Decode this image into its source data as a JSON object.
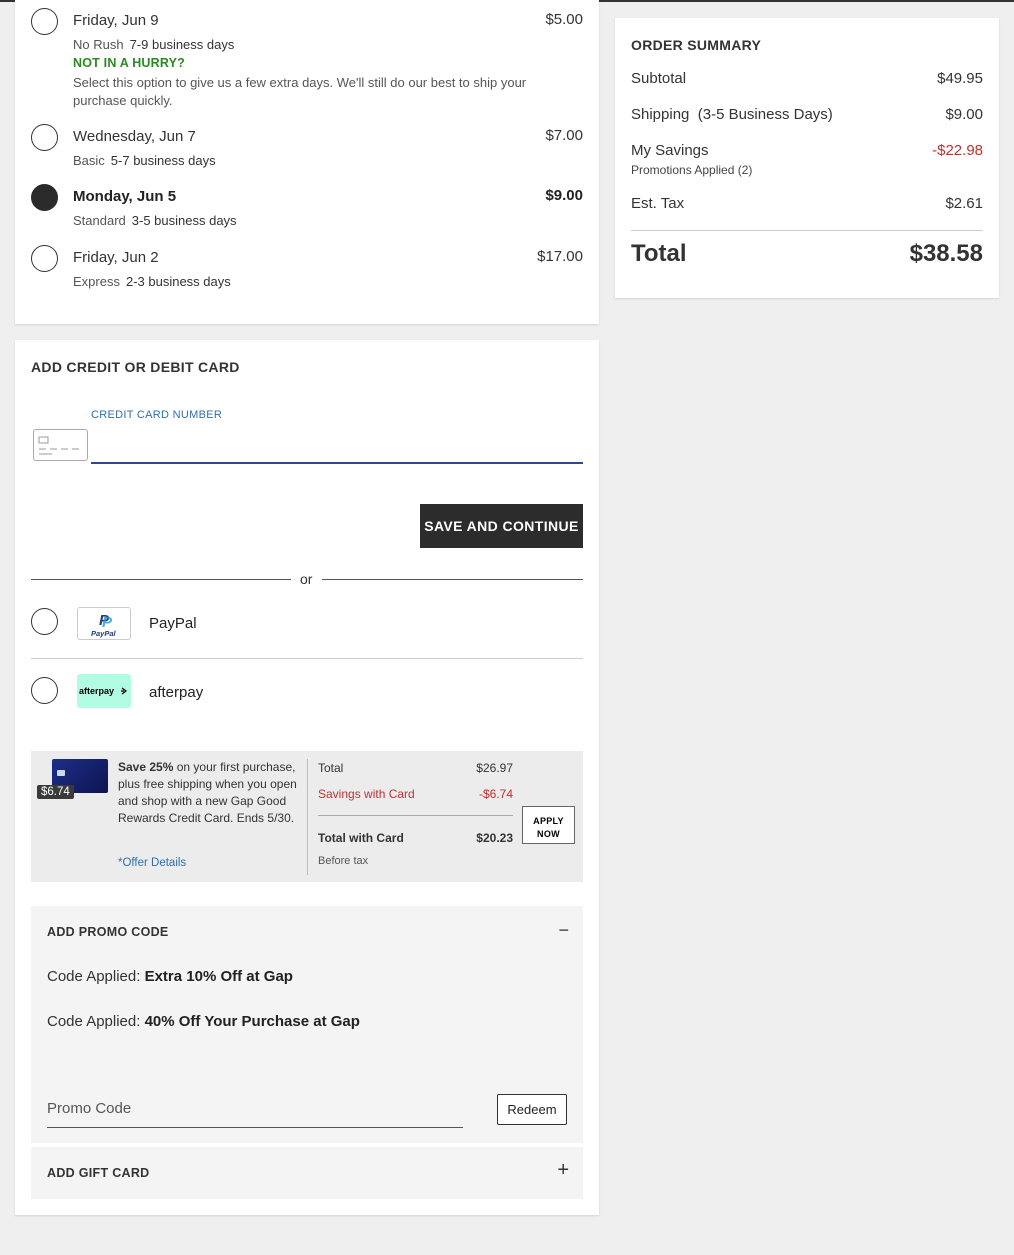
{
  "shipping": {
    "options": [
      {
        "date": "Friday, Jun 9",
        "price": "$5.00",
        "tier": "No Rush",
        "days": "7-9 business days",
        "selected": false,
        "note_title": "NOT IN A HURRY?",
        "note_text": "Select this option to give us a few extra days. We'll still do our best to ship your purchase quickly."
      },
      {
        "date": "Wednesday, Jun 7",
        "price": "$7.00",
        "tier": "Basic",
        "days": "5-7 business days",
        "selected": false
      },
      {
        "date": "Monday, Jun 5",
        "price": "$9.00",
        "tier": "Standard",
        "days": "3-5 business days",
        "selected": true
      },
      {
        "date": "Friday, Jun 2",
        "price": "$17.00",
        "tier": "Express",
        "days": "2-3 business days",
        "selected": false
      }
    ]
  },
  "payment": {
    "title": "ADD CREDIT OR DEBIT CARD",
    "card_number_label": "CREDIT CARD NUMBER",
    "card_number_value": "",
    "save_button": "SAVE AND CONTINUE",
    "or_text": "or",
    "paypal": {
      "label": "PayPal",
      "logo_text": "PayPal"
    },
    "afterpay": {
      "label": "afterpay",
      "logo_text": "afterpay"
    }
  },
  "rewards": {
    "badge": "$6.74",
    "promo_bold": "Save 25%",
    "promo_text": " on your first purchase, plus free shipping when you open and shop with a new Gap Good Rewards Credit Card. Ends 5/30.",
    "offer_link": "*Offer Details",
    "total_label": "Total",
    "total_value": "$26.97",
    "savings_label": "Savings with Card",
    "savings_value": "-$6.74",
    "card_total_label": "Total with Card",
    "card_total_value": "$20.23",
    "before_tax": "Before tax",
    "apply_line1": "APPLY",
    "apply_line2": "NOW"
  },
  "promo": {
    "title": "ADD PROMO CODE",
    "toggle": "−",
    "code_prefix": "Code Applied: ",
    "codes": [
      "Extra 10% Off at Gap",
      "40% Off Your Purchase at Gap"
    ],
    "input_placeholder": "Promo Code",
    "redeem_button": "Redeem"
  },
  "gift": {
    "title": "ADD GIFT CARD",
    "toggle": "+"
  },
  "summary": {
    "title": "ORDER SUMMARY",
    "subtotal_label": "Subtotal",
    "subtotal_value": "$49.95",
    "shipping_label": "Shipping",
    "shipping_detail": "(3-5 Business Days)",
    "shipping_value": "$9.00",
    "savings_label": "My Savings",
    "savings_value": "-$22.98",
    "promotions_applied": "Promotions Applied (2)",
    "tax_label": "Est. Tax",
    "tax_value": "$2.61",
    "total_label": "Total",
    "total_value": "$38.58"
  },
  "colors": {
    "savings_red": "#c03030",
    "hurry_green": "#2a8a22",
    "link_blue": "#2f6fb0",
    "afterpay_mint": "#b2fce4"
  }
}
